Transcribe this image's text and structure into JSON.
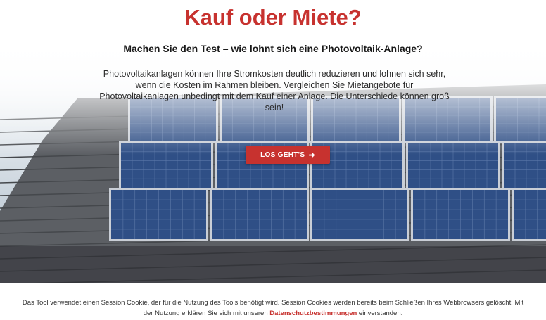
{
  "hero": {
    "title": "Kauf oder Miete?",
    "subtitle": "Machen Sie den Test – wie lohnt sich eine Photovoltaik-Anlage?",
    "intro": "Photovoltaikanlagen können Ihre Stromkosten deutlich reduzieren und lohnen sich sehr, wenn die Kosten im Rahmen bleiben. Vergleichen Sie Mietangebote für Photovoltaikanlagen unbedingt mit dem Kauf einer Anlage. Die Unterschiede können groß sein!",
    "cta_label": "LOS GEHT'S",
    "cta_icon": "arrow-right-icon",
    "background_image": "solar-panels-on-roof"
  },
  "footer": {
    "text_before": "Das Tool verwendet einen Session Cookie, der für die Nutzung des Tools benötigt wird. Session Cookies werden bereits beim Schließen Ihres Webbrowsers gelöscht. Mit der Nutzung erklären Sie sich mit unseren ",
    "link_label": "Datenschutzbestimmungen",
    "text_after": " einverstanden."
  },
  "colors": {
    "accent": "#c7322f",
    "panel_cell": "#2f4f86",
    "panel_frame": "#c9ced6",
    "roof_tile": "#5c5f64"
  }
}
